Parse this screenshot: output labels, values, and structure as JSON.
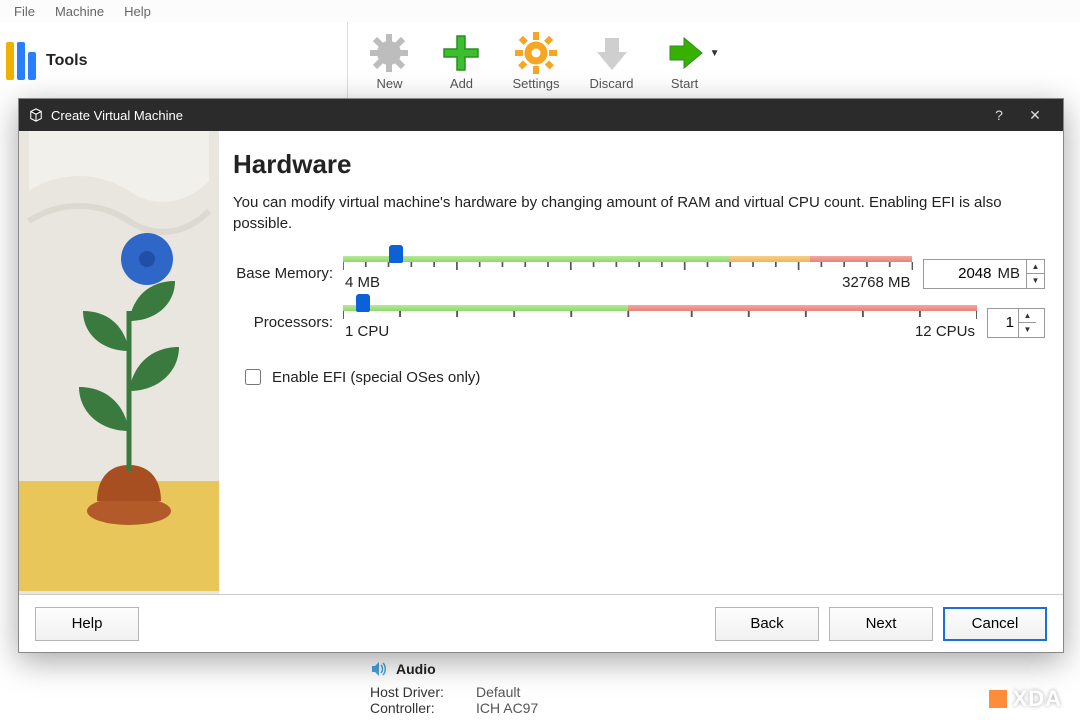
{
  "menubar": {
    "file": "File",
    "machine": "Machine",
    "help": "Help"
  },
  "tools_label": "Tools",
  "toolbar": {
    "new": "New",
    "add": "Add",
    "settings": "Settings",
    "discard": "Discard",
    "start": "Start"
  },
  "dialog": {
    "title": "Create Virtual Machine",
    "heading": "Hardware",
    "description": "You can modify virtual machine's hardware by changing amount of RAM and virtual CPU count. Enabling EFI is also possible.",
    "memory": {
      "label": "Base Memory:",
      "min_label": "4 MB",
      "max_label": "32768 MB",
      "value": "2048",
      "unit": "MB",
      "percent": 8
    },
    "processors": {
      "label": "Processors:",
      "min_label": "1 CPU",
      "max_label": "12 CPUs",
      "value": "1",
      "percent": 2
    },
    "efi_label": "Enable EFI (special OSes only)",
    "buttons": {
      "help": "Help",
      "back": "Back",
      "next": "Next",
      "cancel": "Cancel"
    }
  },
  "background": {
    "audio_header": "Audio",
    "host_driver_k": "Host Driver:",
    "host_driver_v": "Default",
    "controller_k": "Controller:",
    "controller_v": "ICH AC97"
  },
  "watermark": "XDA"
}
